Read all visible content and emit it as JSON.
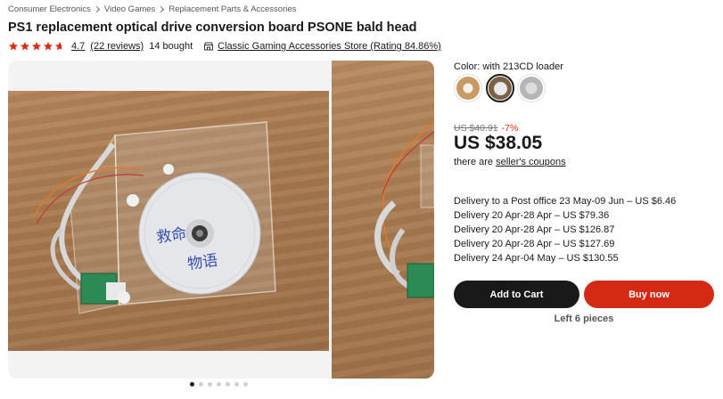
{
  "breadcrumb": [
    "Consumer Electronics",
    "Video Games",
    "Replacement Parts & Accessories"
  ],
  "product": {
    "title": "PS1 replacement optical drive conversion board PSONE bald head",
    "rating": "4.7",
    "reviews": "(22 reviews)",
    "sold": "14 bought",
    "store": "Classic Gaming Accessories Store (Rating 84.86%)"
  },
  "gallery": {
    "image_count": 7,
    "active_index": 0,
    "overlay_text_1": "救命",
    "overlay_text_2": "物语"
  },
  "options": {
    "color_label": "Color: with 213CD loader",
    "swatches": [
      "variant-1",
      "variant-2",
      "variant-3"
    ],
    "selected_index": 1
  },
  "pricing": {
    "old_price": "US $40.91",
    "discount": "-7%",
    "price": "US $38.05",
    "coupon_prefix": "there are",
    "coupon_link": "seller's coupons"
  },
  "delivery": [
    "Delivery to a Post office 23 May-09 Jun – US $6.46",
    "Delivery 20 Apr-28 Apr – US $79.36",
    "Delivery 20 Apr-28 Apr – US $126.87",
    "Delivery 20 Apr-28 Apr – US $127.69",
    "Delivery 24 Apr-04 May – US $130.55"
  ],
  "actions": {
    "add_to_cart": "Add to Cart",
    "buy_now": "Buy now",
    "stock": "Left 6 pieces"
  },
  "colors": {
    "star": "#e0270f",
    "buy": "#d42a13",
    "cart": "#191919",
    "discount": "#e0270f"
  },
  "icons": [
    "star-icon",
    "store-icon",
    "chevron-right-icon"
  ]
}
